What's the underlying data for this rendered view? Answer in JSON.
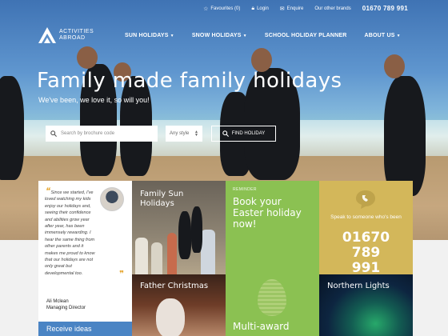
{
  "topbar": {
    "favourites": "Favourites (0)",
    "login": "Login",
    "enquire": "Enquire",
    "other_brands": "Our other brands",
    "phone": "01670 789 991"
  },
  "logo": {
    "line1": "ACTIVITIES",
    "line2": "ABROAD"
  },
  "nav": [
    {
      "label": "SUN HOLIDAYS",
      "caret": true
    },
    {
      "label": "SNOW HOLIDAYS",
      "caret": true
    },
    {
      "label": "SCHOOL HOLIDAY PLANNER",
      "caret": false
    },
    {
      "label": "ABOUT US",
      "caret": true
    }
  ],
  "hero": {
    "headline": "Family made family holidays",
    "subheadline": "We've been, we love it, so will you!"
  },
  "search": {
    "placeholder": "Search by brochure code",
    "style_select": "Any style",
    "find_button": "FIND HOLIDAY"
  },
  "testimonial": {
    "quote": "Since we started, I've loved watching my kids enjoy our holidays and, seeing their confidence and abilities grow year after year, has been immensely rewarding. I hear the same thing from other parents and it makes me proud to know that our holidays are not only great but developmental too.",
    "name": "Ali Mclean",
    "role": "Managing Director"
  },
  "tiles": {
    "family_sun": "Family Sun Holidays",
    "easter_tag": "REMINDER",
    "easter": "Book your Easter holiday now!",
    "speak_text": "Speak to someone who's been",
    "speak_phone": "01670 789 991",
    "father_christmas": "Father Christmas",
    "award": "Multi-award",
    "northern_lights": "Northern Lights",
    "receive": "Receive ideas"
  },
  "colors": {
    "green": "#8bc152",
    "gold": "#d3b75a",
    "blue": "#4a84c4",
    "quote_accent": "#e6a62f"
  }
}
